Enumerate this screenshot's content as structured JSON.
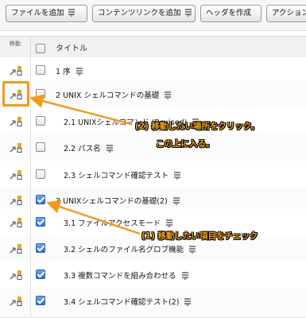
{
  "toolbar": {
    "buttons": [
      {
        "label": "ファイルを追加"
      },
      {
        "label": "コンテンツリンクを追加"
      },
      {
        "label": "ヘッダを作成"
      },
      {
        "label": "アクションメ"
      }
    ]
  },
  "table": {
    "header_move": "移動",
    "header_title": "タイトル",
    "rows": [
      {
        "title": "1 序",
        "checked": false
      },
      {
        "title": "2 UNIX シェルコマンドの基礎",
        "checked": false
      },
      {
        "title": "2.1 UNIXシェルコマンド (Revised)",
        "checked": false
      },
      {
        "title": "2.2 パス名",
        "checked": false
      },
      {
        "title": "2.3 シェルコマンド確認テスト",
        "checked": false
      },
      {
        "title": "3 UNIXシェルコマンドの基礎(2)",
        "checked": true
      },
      {
        "title": "3.1 ファイルアクセスモード",
        "checked": true
      },
      {
        "title": "3.2 シェルのファイル名グロブ機能",
        "checked": true
      },
      {
        "title": "3.3 複数コマンドを組み合わせる",
        "checked": true
      },
      {
        "title": "3.4 シェルコマンド確認テスト(2)",
        "checked": true
      }
    ]
  },
  "annotations": {
    "step2_line1": "(2) 移動したい場所をクリック。",
    "step2_line2": "この上に入る。",
    "step1": "(1) 移動したい項目をチェック"
  },
  "colors": {
    "accent": "#f39a1e",
    "checkbox_checked": "#2d6fd3"
  }
}
